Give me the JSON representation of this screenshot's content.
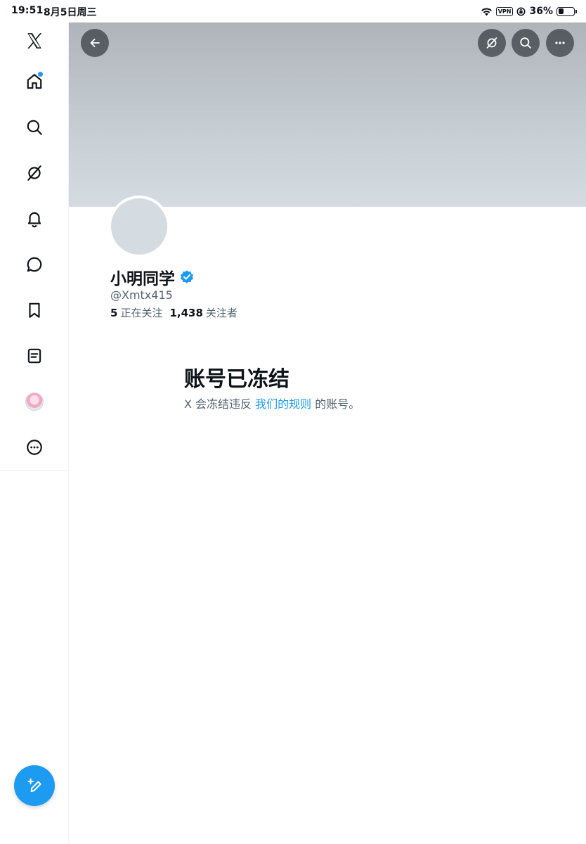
{
  "status_bar": {
    "time": "19:51",
    "date": "8月5日周三",
    "vpn": "VPN",
    "battery": "36%",
    "battery_level": 0.36
  },
  "sidebar": {
    "items": [
      {
        "name": "x-logo",
        "icon": "x-logo-icon"
      },
      {
        "name": "home",
        "icon": "home-icon",
        "has_dot": true
      },
      {
        "name": "explore",
        "icon": "search-icon"
      },
      {
        "name": "grok",
        "icon": "grok-icon"
      },
      {
        "name": "notifications",
        "icon": "bell-icon"
      },
      {
        "name": "messages",
        "icon": "message-icon"
      },
      {
        "name": "bookmarks",
        "icon": "bookmark-icon"
      },
      {
        "name": "lists",
        "icon": "list-icon"
      },
      {
        "name": "profile",
        "icon": "avatar"
      },
      {
        "name": "more",
        "icon": "more-circle-icon"
      }
    ],
    "compose_icon": "compose-icon"
  },
  "profile": {
    "display_name": "小明同学",
    "verified": true,
    "handle": "@Xmtx415",
    "following_count": "5",
    "following_label": "正在关注",
    "followers_count": "1,438",
    "followers_label": "关注者"
  },
  "notice": {
    "title": "账号已冻结",
    "text_before": "X 会冻结违反",
    "link_text": "我们的规则",
    "text_after": "的账号。"
  },
  "colors": {
    "accent": "#1d9bf0",
    "text_primary": "#0f1419",
    "text_secondary": "#536471"
  }
}
